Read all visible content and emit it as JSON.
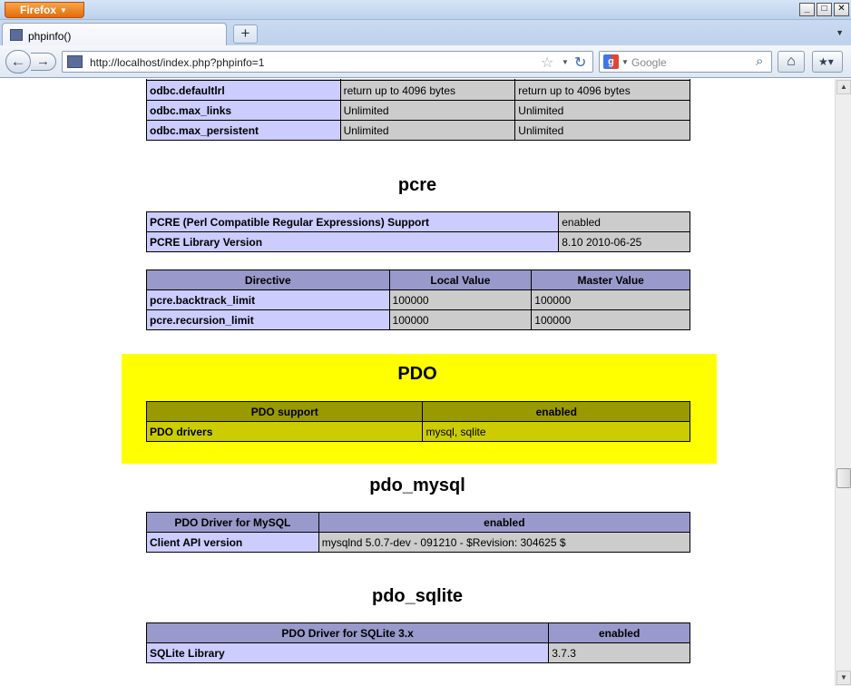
{
  "browser": {
    "app_button": "Firefox",
    "tab_title": "phpinfo()",
    "url": "http://localhost/index.php?phpinfo=1",
    "search_placeholder": "Google",
    "search_engine_letter": "g"
  },
  "odbc_rows": [
    {
      "directive": "odbc.defaultlrl",
      "local": "return up to 4096 bytes",
      "master": "return up to 4096 bytes"
    },
    {
      "directive": "odbc.max_links",
      "local": "Unlimited",
      "master": "Unlimited"
    },
    {
      "directive": "odbc.max_persistent",
      "local": "Unlimited",
      "master": "Unlimited"
    }
  ],
  "pcre": {
    "heading": "pcre",
    "info": [
      {
        "label": "PCRE (Perl Compatible Regular Expressions) Support",
        "value": "enabled"
      },
      {
        "label": "PCRE Library Version",
        "value": "8.10 2010-06-25"
      }
    ],
    "headers": [
      "Directive",
      "Local Value",
      "Master Value"
    ],
    "directives": [
      {
        "directive": "pcre.backtrack_limit",
        "local": "100000",
        "master": "100000"
      },
      {
        "directive": "pcre.recursion_limit",
        "local": "100000",
        "master": "100000"
      }
    ]
  },
  "pdo": {
    "heading": "PDO",
    "headers": [
      "PDO support",
      "enabled"
    ],
    "rows": [
      {
        "label": "PDO drivers",
        "value": "mysql, sqlite"
      }
    ]
  },
  "pdo_mysql": {
    "heading": "pdo_mysql",
    "headers": [
      "PDO Driver for MySQL",
      "enabled"
    ],
    "rows": [
      {
        "label": "Client API version",
        "value": "mysqlnd 5.0.7-dev - 091210 - $Revision: 304625 $"
      }
    ]
  },
  "pdo_sqlite": {
    "heading": "pdo_sqlite",
    "headers": [
      "PDO Driver for SQLite 3.x",
      "enabled"
    ],
    "rows": [
      {
        "label": "SQLite Library",
        "value": "3.7.3"
      }
    ]
  },
  "colors": {
    "header_bg": "#9999cc",
    "label_bg": "#ccccff",
    "value_bg": "#cccccc",
    "highlight": "#ffff00"
  }
}
